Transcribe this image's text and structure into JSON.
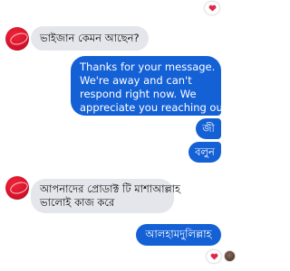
{
  "messages": {
    "incoming_1": "ভাইজান কেমন আছেন?",
    "outgoing_auto_reply": {
      "line1": "Thanks for your message.",
      "line2": "We're away and can't",
      "line3": "respond right now. We",
      "line4": "appreciate you reaching out."
    },
    "outgoing_2": "জী",
    "outgoing_3": "বলুন",
    "incoming_2": {
      "line1": "আপনাদের প্রোডাক্ট টি মাশাআল্লাহ",
      "line2": "ভালোই কাজ করে"
    },
    "outgoing_4": "আলহামদুলিল্লাহ"
  },
  "reactions": {
    "heart_color": "#e0284a"
  },
  "colors": {
    "outgoing_bubble": "#1461d6",
    "incoming_bubble": "#e4e6eb"
  }
}
